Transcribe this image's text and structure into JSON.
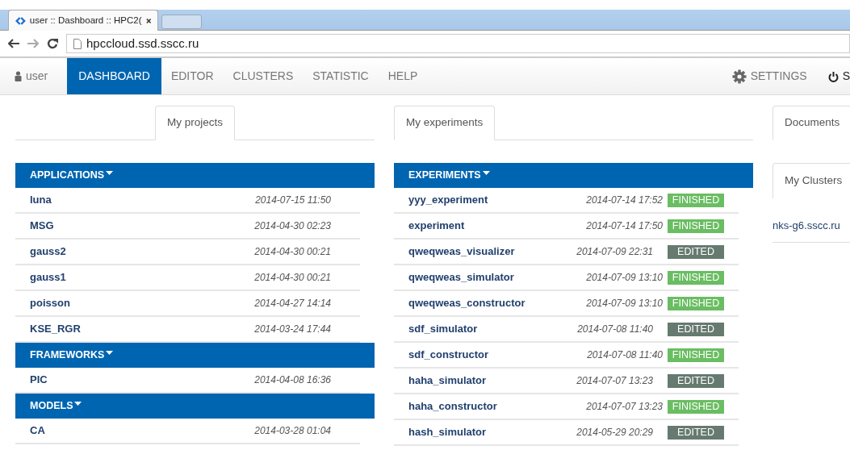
{
  "browser": {
    "tab_title": "user :: Dashboard :: HPC2(",
    "url": "hpccloud.ssd.sscc.ru"
  },
  "navbar": {
    "user": "user",
    "items": [
      {
        "label": "DASHBOARD",
        "selected": true
      },
      {
        "label": "EDITOR",
        "selected": false
      },
      {
        "label": "CLUSTERS",
        "selected": false
      },
      {
        "label": "STATISTIC",
        "selected": false
      },
      {
        "label": "HELP",
        "selected": false
      }
    ],
    "settings": "SETTINGS",
    "signout": "S"
  },
  "projects": {
    "tab": "My projects",
    "groups": [
      {
        "title": "APPLICATIONS",
        "items": [
          {
            "name": "luna",
            "date": "2014-07-15 11:50"
          },
          {
            "name": "MSG",
            "date": "2014-04-30 02:23"
          },
          {
            "name": "gauss2",
            "date": "2014-04-30 00:21"
          },
          {
            "name": "gauss1",
            "date": "2014-04-30 00:21"
          },
          {
            "name": "poisson",
            "date": "2014-04-27 14:14"
          },
          {
            "name": "KSE_RGR",
            "date": "2014-03-24 17:44"
          }
        ]
      },
      {
        "title": "FRAMEWORKS",
        "items": [
          {
            "name": "PIC",
            "date": "2014-04-08 16:36"
          }
        ]
      },
      {
        "title": "MODELS",
        "items": [
          {
            "name": "CA",
            "date": "2014-03-28 01:04"
          }
        ]
      }
    ]
  },
  "experiments": {
    "tab": "My experiments",
    "title": "EXPERIMENTS",
    "rows": [
      {
        "name": "yyy_experiment",
        "date": "2014-07-14 17:52",
        "status": "FINISHED",
        "kind": "finished"
      },
      {
        "name": "experiment",
        "date": "2014-07-14 17:50",
        "status": "FINISHED",
        "kind": "finished"
      },
      {
        "name": "qweqweas_visualizer",
        "date": "2014-07-09 22:31",
        "status": "EDITED",
        "kind": "edited"
      },
      {
        "name": "qweqweas_simulator",
        "date": "2014-07-09 13:10",
        "status": "FINISHED",
        "kind": "finished"
      },
      {
        "name": "qweqweas_constructor",
        "date": "2014-07-09 13:10",
        "status": "FINISHED",
        "kind": "finished"
      },
      {
        "name": "sdf_simulator",
        "date": "2014-07-08 11:40",
        "status": "EDITED",
        "kind": "edited"
      },
      {
        "name": "sdf_constructor",
        "date": "2014-07-08 11:40",
        "status": "FINISHED",
        "kind": "finished"
      },
      {
        "name": "haha_simulator",
        "date": "2014-07-07 13:23",
        "status": "EDITED",
        "kind": "edited"
      },
      {
        "name": "haha_constructor",
        "date": "2014-07-07 13:23",
        "status": "FINISHED",
        "kind": "finished"
      },
      {
        "name": "hash_simulator",
        "date": "2014-05-29 20:29",
        "status": "EDITED",
        "kind": "edited"
      }
    ]
  },
  "sidebar": {
    "documents_tab": "Documents",
    "clusters_tab": "My Clusters",
    "clusters": [
      "nks-g6.sscc.ru"
    ]
  }
}
